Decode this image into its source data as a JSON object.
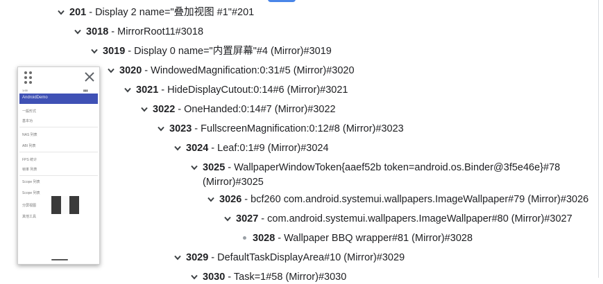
{
  "tree": {
    "rows": [
      {
        "id": "201",
        "rest": " - Display 2 name=\"叠加视图 #1\"#201",
        "has_children": true
      },
      {
        "id": "3018",
        "rest": " - MirrorRoot11#3018",
        "has_children": true
      },
      {
        "id": "3019",
        "rest": " - Display 0 name=\"内置屏幕\"#4 (Mirror)#3019",
        "has_children": true
      },
      {
        "id": "3020",
        "rest": " - WindowedMagnification:0:31#5 (Mirror)#3020",
        "has_children": true
      },
      {
        "id": "3021",
        "rest": " - HideDisplayCutout:0:14#6 (Mirror)#3021",
        "has_children": true
      },
      {
        "id": "3022",
        "rest": " - OneHanded:0:14#7 (Mirror)#3022",
        "has_children": true
      },
      {
        "id": "3023",
        "rest": " - FullscreenMagnification:0:12#8 (Mirror)#3023",
        "has_children": true
      },
      {
        "id": "3024",
        "rest": " - Leaf:0:1#9 (Mirror)#3024",
        "has_children": true
      },
      {
        "id": "3025",
        "rest": " - WallpaperWindowToken{aaef52b token=android.os.Binder@3f5e46e}#78",
        "rest2": "(Mirror)#3025",
        "has_children": true
      },
      {
        "id": "3026",
        "rest": " - bcf260 com.android.systemui.wallpapers.ImageWallpaper#79 (Mirror)#3026",
        "has_children": true
      },
      {
        "id": "3027",
        "rest": " - com.android.systemui.wallpapers.ImageWallpaper#80 (Mirror)#3027",
        "has_children": true
      },
      {
        "id": "3028",
        "rest": " - Wallpaper BBQ wrapper#81 (Mirror)#3028",
        "has_children": false
      },
      {
        "id": "3029",
        "rest": " - DefaultTaskDisplayArea#10 (Mirror)#3029",
        "has_children": true
      },
      {
        "id": "3030",
        "rest": " - Task=1#58 (Mirror)#3030",
        "has_children": true
      }
    ]
  },
  "preview": {
    "app_title": "AndroidDemo",
    "status_time": "1:00",
    "items": [
      "一般形式",
      "基本功",
      "NAS 列表",
      "ABI 列表",
      "FPS 统计",
      "帧率 列表",
      "Scope 列表",
      "Scope 列表",
      "分屏视图",
      "其他工具"
    ]
  },
  "colors": {
    "accent": "#3f51b5",
    "tab_accent": "#4a86e8",
    "text": "#202124",
    "chevron": "#3c4043"
  },
  "icons": {
    "expand": "chevron-down-icon",
    "leaf": "bullet-icon",
    "drag": "drag-handle-icon",
    "close": "close-icon"
  }
}
